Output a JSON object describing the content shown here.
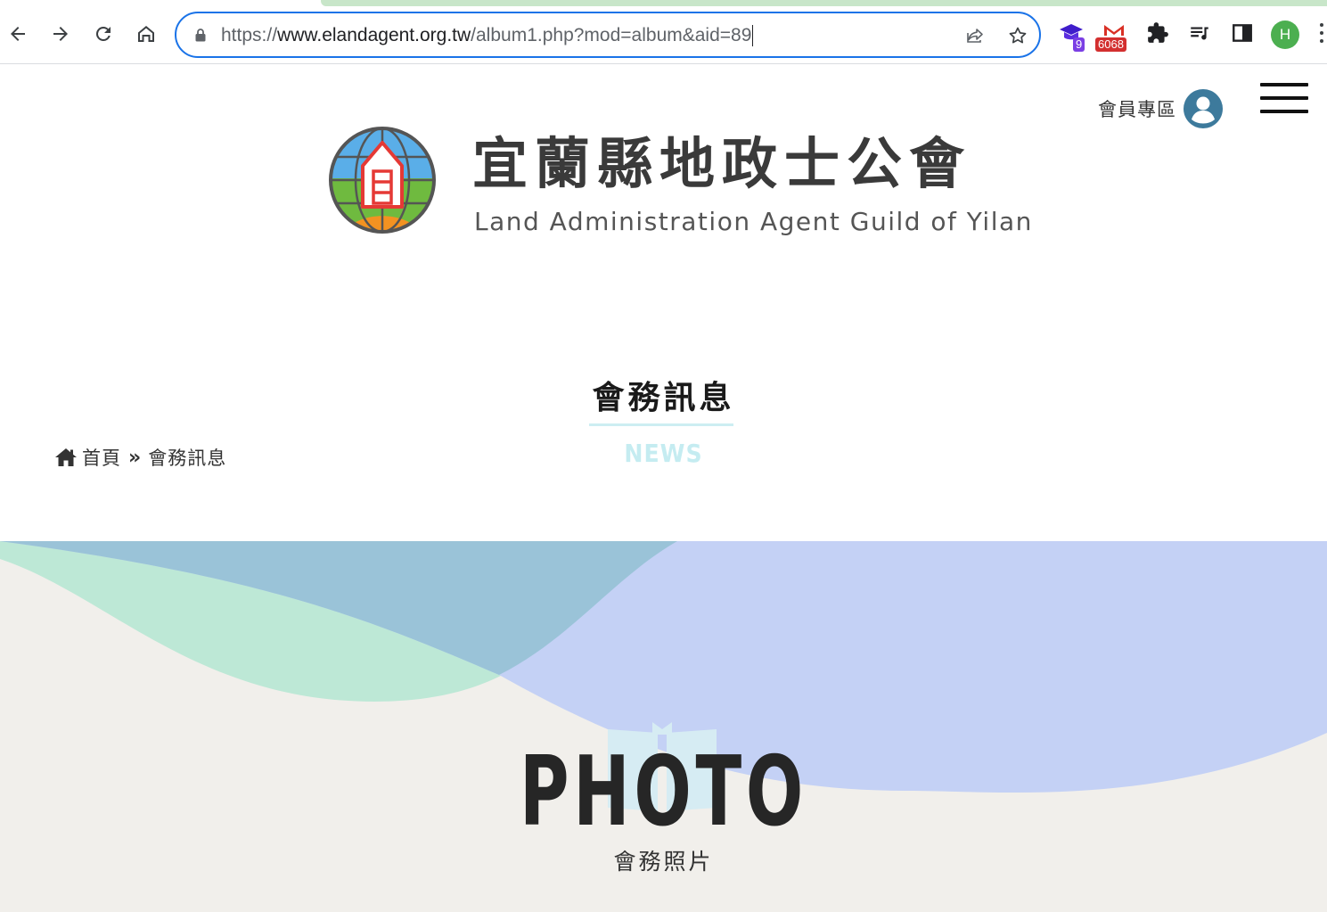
{
  "browser": {
    "url_scheme": "https://",
    "url_host": "www.elandagent.org.tw",
    "url_path": "/album1.php?mod=album&aid=89",
    "extensions": {
      "ext1_badge": "9",
      "gmail_badge": "6068"
    },
    "profile_initial": "H"
  },
  "header": {
    "member_label": "會員專區",
    "logo_cn": "宜蘭縣地政士公會",
    "logo_en": "Land Administration Agent Guild of Yilan"
  },
  "section": {
    "title": "會務訊息",
    "subtitle": "NEWS"
  },
  "breadcrumb": {
    "home": "首頁",
    "current": "會務訊息"
  },
  "banner": {
    "title": "PHOTO",
    "subtitle": "會務照片"
  },
  "colors": {
    "accent_blue": "#1a73e8",
    "logo_green": "#6fba3f",
    "logo_blue": "#4aa3e8",
    "logo_orange": "#f39221",
    "logo_red": "#e53935",
    "wave_mint": "#bde8d6",
    "wave_teal": "#9ac3d8",
    "wave_periwinkle": "#c4d1f5",
    "banner_bg": "#f1efeb"
  }
}
